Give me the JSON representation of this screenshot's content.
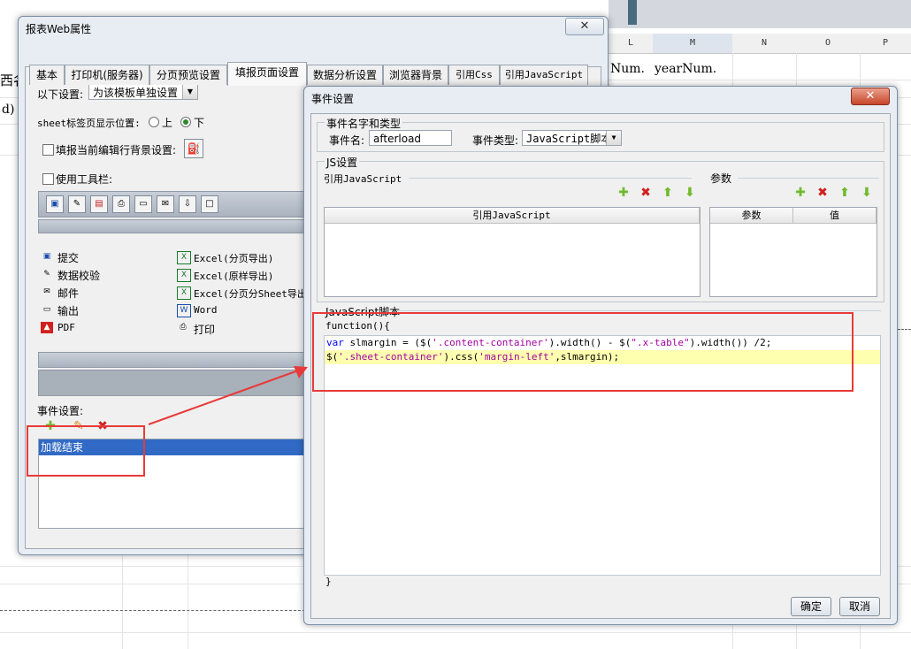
{
  "spreadsheet": {
    "columns": [
      "L",
      "M",
      "N",
      "O",
      "P"
    ],
    "cells": {
      "l_value": "Num.",
      "m_value": "yearNum.",
      "left_fragment_1": "西名",
      "left_fragment_2": "d)"
    }
  },
  "web_attr_dialog": {
    "title": "报表Web属性",
    "close_label": "✕",
    "tabs": [
      "基本",
      "打印机(服务器)",
      "分页预览设置",
      "填报页面设置",
      "数据分析设置",
      "浏览器背景",
      "引用Css",
      "引用JavaScript"
    ],
    "active_tab": "填报页面设置",
    "settings_label": "以下设置:",
    "settings_value": "为该模板单独设置",
    "sheet_tab_pos_label": "sheet标签页显示位置:",
    "sheet_tab_pos_options": [
      "上",
      "下"
    ],
    "sheet_tab_pos_selected": "下",
    "fill_row_bg_label": "填报当前编辑行背景设置:",
    "use_toolbar_label": "使用工具栏:",
    "toolbar_items": [
      {
        "label": "提交",
        "icon": "save-icon"
      },
      {
        "label": "数据校验",
        "icon": "check-icon"
      },
      {
        "label": "邮件",
        "icon": "mail-icon"
      },
      {
        "label": "输出",
        "icon": "export-icon"
      },
      {
        "label": "PDF",
        "icon": "pdf-icon"
      }
    ],
    "toolbar_items_right": [
      {
        "label": "Excel(分页导出)",
        "icon": "excel-icon"
      },
      {
        "label": "Excel(原样导出)",
        "icon": "excel-icon"
      },
      {
        "label": "Excel(分页分Sheet导出",
        "icon": "excel-icon"
      },
      {
        "label": "Word",
        "icon": "word-icon"
      },
      {
        "label": "打印",
        "icon": "print-icon"
      }
    ],
    "event_settings_label": "事件设置:",
    "events": [
      "加载结束"
    ]
  },
  "event_dialog": {
    "title": "事件设置",
    "close_label": "✕",
    "name_type_group": "事件名字和类型",
    "event_name_label": "事件名:",
    "event_name_value": "afterload",
    "event_type_label": "事件类型:",
    "event_type_value": "JavaScript脚本",
    "js_settings_group": "JS设置",
    "ref_js_group": "引用JavaScript",
    "params_group": "参数",
    "ref_js_header": "引用JavaScript",
    "params_headers": [
      "参数",
      "值"
    ],
    "script_group": "JavaScript脚本",
    "code": {
      "line1": "function(){",
      "line2_kw": "var",
      "line2_a": " slmargin = ($(",
      "line2_s1": "'.content-container'",
      "line2_b": ").width() - $(",
      "line2_s2": "\".x-table\"",
      "line2_c": ").width()) /2;",
      "line3_a": "$(",
      "line3_s1": "'.sheet-container'",
      "line3_b": ").css(",
      "line3_s2": "'margin-left'",
      "line3_c": ",slmargin);",
      "closing": "}"
    },
    "ok_label": "确定",
    "cancel_label": "取消"
  }
}
